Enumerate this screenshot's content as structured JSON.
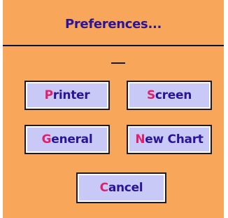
{
  "dialog": {
    "title": "Preferences...",
    "buttons": {
      "printer": {
        "hotkey": "P",
        "rest": "rinter"
      },
      "screen": {
        "hotkey": "S",
        "rest": "creen"
      },
      "general": {
        "hotkey": "G",
        "rest": "eneral"
      },
      "new_chart": {
        "hotkey": "N",
        "rest": "ew Chart"
      },
      "cancel": {
        "hotkey": "C",
        "rest": "ancel"
      }
    }
  },
  "colors": {
    "background": "#f7a65a",
    "button_face": "#c9c9f7",
    "label_text": "#2a1499",
    "hotkey_text": "#e0206a",
    "title_rule": "#101048"
  }
}
